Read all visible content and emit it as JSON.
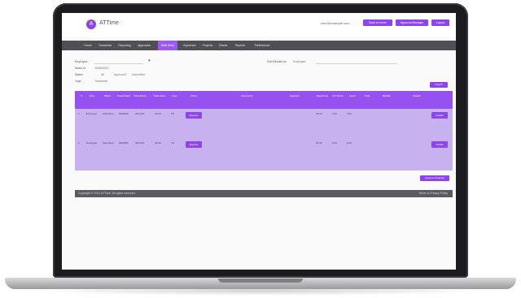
{
  "app": {
    "logo_letter": "A",
    "title": "ATTime"
  },
  "header": {
    "user_text": "user@example.com",
    "buttons": [
      "Back to home",
      "Approval Manager",
      "Logout"
    ]
  },
  "nav": {
    "items": [
      "Home",
      "Timesheet",
      "Reporting",
      "Approvals",
      "Bulk Entry",
      "Expenses",
      "Projects",
      "Clients",
      "Reports",
      "Preferences"
    ],
    "active_index": 4
  },
  "filters": {
    "employee_label": "Employee",
    "employee_value": "",
    "week_label": "Week of",
    "week_value": "03/08/2021",
    "status_label": "Status",
    "status_options": [
      "All",
      "Approved",
      "Submitted"
    ],
    "type_label": "Type",
    "type_value": "Timesheet",
    "sort_label": "Sort Results by",
    "sort_value": "Employee",
    "search_button": "Search"
  },
  "table": {
    "columns": [
      "#",
      "Emp",
      "Status",
      "Period Start",
      "Period End",
      "Total Hours",
      "Type",
      "Action",
      "Comments",
      "Approver",
      "Reg Hours",
      "OT Hours",
      "Leave",
      "Total",
      "Billable",
      "Details"
    ],
    "rows": [
      {
        "id": "1",
        "emp": "Employee",
        "status": "Submitted",
        "start": "03/08/21",
        "end": "03/14/21",
        "hours": "40.00",
        "type": "TS",
        "action": "Approve",
        "reg": "40.00",
        "ot": "0.00",
        "leave": "0.00",
        "view": "Details"
      },
      {
        "id": "2",
        "emp": "Employee",
        "status": "Submitted",
        "start": "03/08/21",
        "end": "03/14/21",
        "hours": "32.00",
        "type": "TS",
        "action": "Approve",
        "reg": "32.00",
        "ot": "0.00",
        "leave": "0.00",
        "view": "Details"
      }
    ]
  },
  "bulk_button": "Approve Selected",
  "footer": {
    "left": "Copyright © 2021 ATTime. All rights reserved.",
    "right": "Terms & Privacy Policy"
  }
}
